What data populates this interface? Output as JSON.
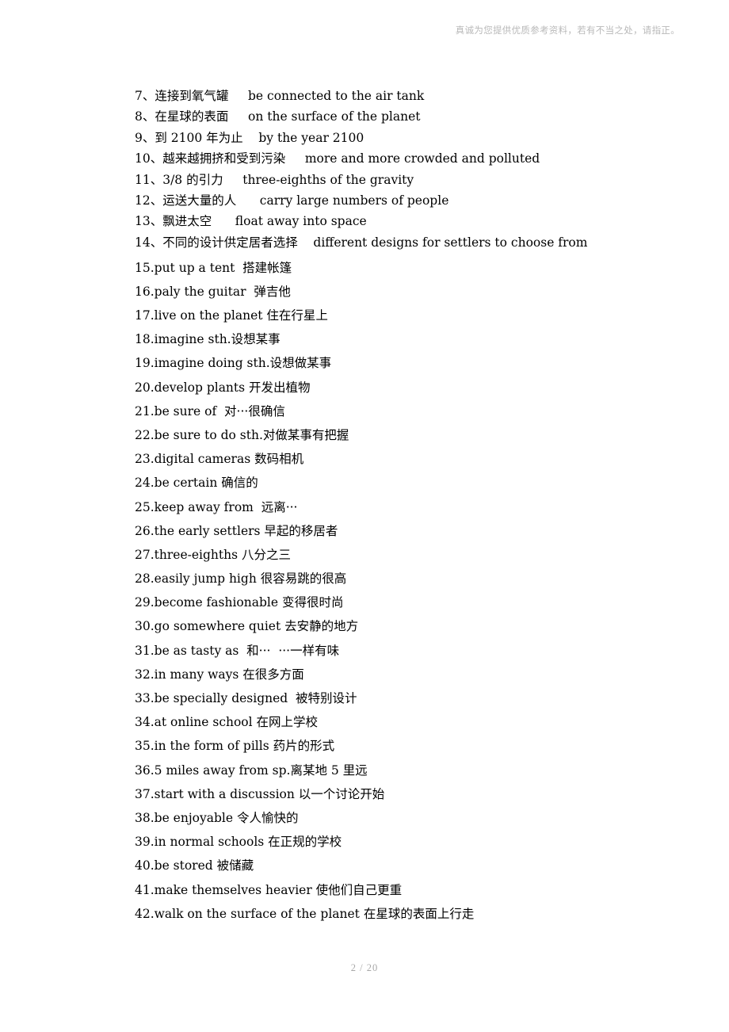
{
  "header": {
    "notice": "真诚为您提供优质参考资料，若有不当之处，请指正。"
  },
  "footer": {
    "page_indicator": "2 / 20"
  },
  "body": {
    "group_tight": [
      "7、连接到氧气罐     be connected to the air tank",
      "8、在星球的表面     on the surface of the planet",
      "9、到 2100 年为止    by the year 2100",
      "10、越来越拥挤和受到污染     more and more crowded and polluted",
      "11、3/8 的引力     three-eighths of the gravity",
      "12、运送大量的人      carry large numbers of people",
      "13、飘进太空      float away into space",
      "14、不同的设计供定居者选择    different designs for settlers to choose from"
    ],
    "group_loose": [
      "15.put up a tent  搭建帐篷",
      "16.paly the guitar  弹吉他",
      "17.live on the planet 住在行星上",
      "18.imagine sth.设想某事",
      "19.imagine doing sth.设想做某事",
      "20.develop plants 开发出植物",
      "21.be sure of  对···很确信",
      "22.be sure to do sth.对做某事有把握",
      "23.digital cameras 数码相机",
      "24.be certain 确信的",
      "25.keep away from  远离···",
      "26.the early settlers 早起的移居者",
      "27.three-eighths 八分之三",
      "28.easily jump high 很容易跳的很高",
      "29.become fashionable 变得很时尚",
      "30.go somewhere quiet 去安静的地方",
      "31.be as tasty as  和···  ···一样有味",
      "32.in many ways 在很多方面",
      "33.be specially designed  被特别设计",
      "34.at online school 在网上学校",
      "35.in the form of pills 药片的形式",
      "36.5 miles away from sp.离某地 5 里远",
      "37.start with a discussion 以一个讨论开始",
      "38.be enjoyable 令人愉快的",
      "39.in normal schools 在正规的学校",
      "40.be stored 被储藏",
      "41.make themselves heavier 使他们自己更重",
      "42.walk on the surface of the planet 在星球的表面上行走"
    ]
  }
}
